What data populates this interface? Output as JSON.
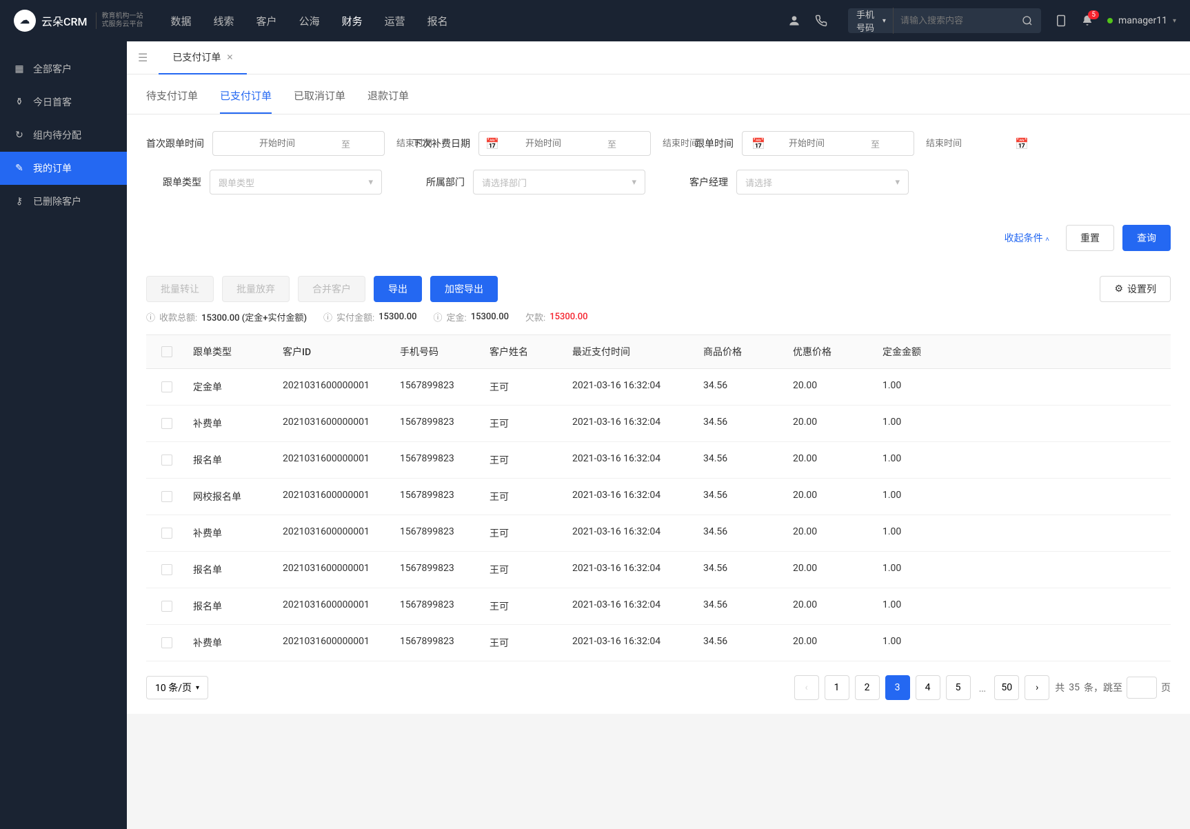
{
  "header": {
    "logo_text": "云朵CRM",
    "logo_sub1": "教育机构一站",
    "logo_sub2": "式服务云平台",
    "nav": [
      "数据",
      "线索",
      "客户",
      "公海",
      "财务",
      "运营",
      "报名"
    ],
    "nav_active": 4,
    "search_type": "手机号码",
    "search_placeholder": "请输入搜索内容",
    "badge": "5",
    "user": "manager11"
  },
  "sidebar": {
    "items": [
      {
        "label": "全部客户"
      },
      {
        "label": "今日首客"
      },
      {
        "label": "组内待分配"
      },
      {
        "label": "我的订单"
      },
      {
        "label": "已删除客户"
      }
    ],
    "active": 3
  },
  "tab": {
    "label": "已支付订单"
  },
  "sub_tabs": [
    "待支付订单",
    "已支付订单",
    "已取消订单",
    "退款订单"
  ],
  "sub_tab_active": 1,
  "filters": {
    "first_follow": "首次跟单时间",
    "next_fee": "下次补费日期",
    "follow_time": "跟单时间",
    "follow_type_label": "跟单类型",
    "follow_type_ph": "跟单类型",
    "dept_label": "所属部门",
    "dept_ph": "请选择部门",
    "manager_label": "客户经理",
    "manager_ph": "请选择",
    "start_ph": "开始时间",
    "end_ph": "结束时间",
    "sep": "至",
    "collapse": "收起条件",
    "reset": "重置",
    "query": "查询"
  },
  "toolbar": {
    "transfer": "批量转让",
    "abandon": "批量放弃",
    "merge": "合并客户",
    "export": "导出",
    "encrypt_export": "加密导出",
    "columns": "设置列"
  },
  "summary": {
    "total_label": "收款总额:",
    "total_val": "15300.00 (定金+实付金额)",
    "paid_label": "实付金额:",
    "paid_val": "15300.00",
    "deposit_label": "定金:",
    "deposit_val": "15300.00",
    "owed_label": "欠款:",
    "owed_val": "15300.00"
  },
  "table": {
    "headers": [
      "跟单类型",
      "客户ID",
      "手机号码",
      "客户姓名",
      "最近支付时间",
      "商品价格",
      "优惠价格",
      "定金金额"
    ],
    "rows": [
      {
        "type": "定金单",
        "id": "2021031600000001",
        "phone": "1567899823",
        "name": "王可",
        "time": "2021-03-16 16:32:04",
        "price": "34.56",
        "discount": "20.00",
        "deposit": "1.00"
      },
      {
        "type": "补费单",
        "id": "2021031600000001",
        "phone": "1567899823",
        "name": "王可",
        "time": "2021-03-16 16:32:04",
        "price": "34.56",
        "discount": "20.00",
        "deposit": "1.00"
      },
      {
        "type": "报名单",
        "id": "2021031600000001",
        "phone": "1567899823",
        "name": "王可",
        "time": "2021-03-16 16:32:04",
        "price": "34.56",
        "discount": "20.00",
        "deposit": "1.00"
      },
      {
        "type": "网校报名单",
        "id": "2021031600000001",
        "phone": "1567899823",
        "name": "王可",
        "time": "2021-03-16 16:32:04",
        "price": "34.56",
        "discount": "20.00",
        "deposit": "1.00"
      },
      {
        "type": "补费单",
        "id": "2021031600000001",
        "phone": "1567899823",
        "name": "王可",
        "time": "2021-03-16 16:32:04",
        "price": "34.56",
        "discount": "20.00",
        "deposit": "1.00"
      },
      {
        "type": "报名单",
        "id": "2021031600000001",
        "phone": "1567899823",
        "name": "王可",
        "time": "2021-03-16 16:32:04",
        "price": "34.56",
        "discount": "20.00",
        "deposit": "1.00"
      },
      {
        "type": "报名单",
        "id": "2021031600000001",
        "phone": "1567899823",
        "name": "王可",
        "time": "2021-03-16 16:32:04",
        "price": "34.56",
        "discount": "20.00",
        "deposit": "1.00"
      },
      {
        "type": "补费单",
        "id": "2021031600000001",
        "phone": "1567899823",
        "name": "王可",
        "time": "2021-03-16 16:32:04",
        "price": "34.56",
        "discount": "20.00",
        "deposit": "1.00"
      }
    ]
  },
  "pagination": {
    "page_size": "10 条/页",
    "pages": [
      "1",
      "2",
      "3",
      "4",
      "5"
    ],
    "last": "50",
    "active": "3",
    "total_prefix": "共",
    "total_count": "35",
    "total_suffix": "条，跳至",
    "page_unit": "页"
  }
}
